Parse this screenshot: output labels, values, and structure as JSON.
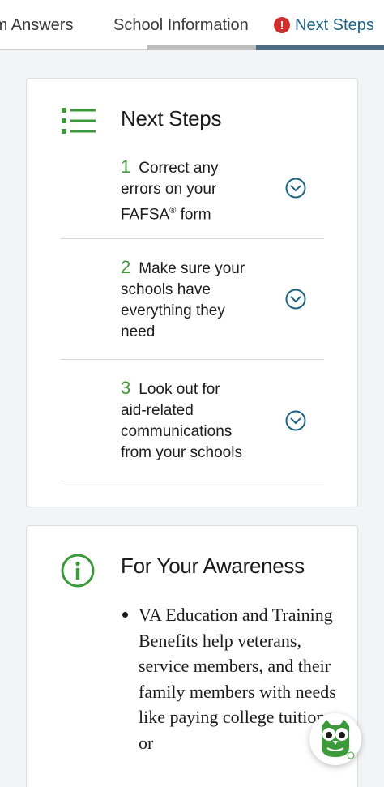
{
  "tabs": {
    "form_answers": "rm Answers",
    "school_information": "School Information",
    "next_steps": "Next Steps",
    "alert_mark": "!"
  },
  "next_steps": {
    "title": "Next Steps",
    "steps": [
      {
        "number": "1",
        "line1": "Correct any",
        "line2": "errors on your",
        "line3": "FAFSA",
        "reg": "®",
        "line3b": " form"
      },
      {
        "number": "2",
        "line1": "Make sure your",
        "line2": "schools have",
        "line3": "everything they",
        "line4": "need"
      },
      {
        "number": "3",
        "line1": "Look out for",
        "line2": "aid-related",
        "line3": "communications",
        "line4": "from your schools"
      }
    ]
  },
  "awareness": {
    "title": "For Your Awareness",
    "items": [
      "VA Education and Training Benefits help veterans, service members, and their family members with needs like paying college tuition or"
    ]
  },
  "icons": {
    "list": "list-icon",
    "info": "info-icon",
    "chevron": "chevron-down-circle-icon",
    "assistant": "owl-assistant-icon"
  },
  "colors": {
    "accent_green": "#3d9a3a",
    "link_blue": "#1f6384",
    "alert_red": "#d12b2b"
  }
}
